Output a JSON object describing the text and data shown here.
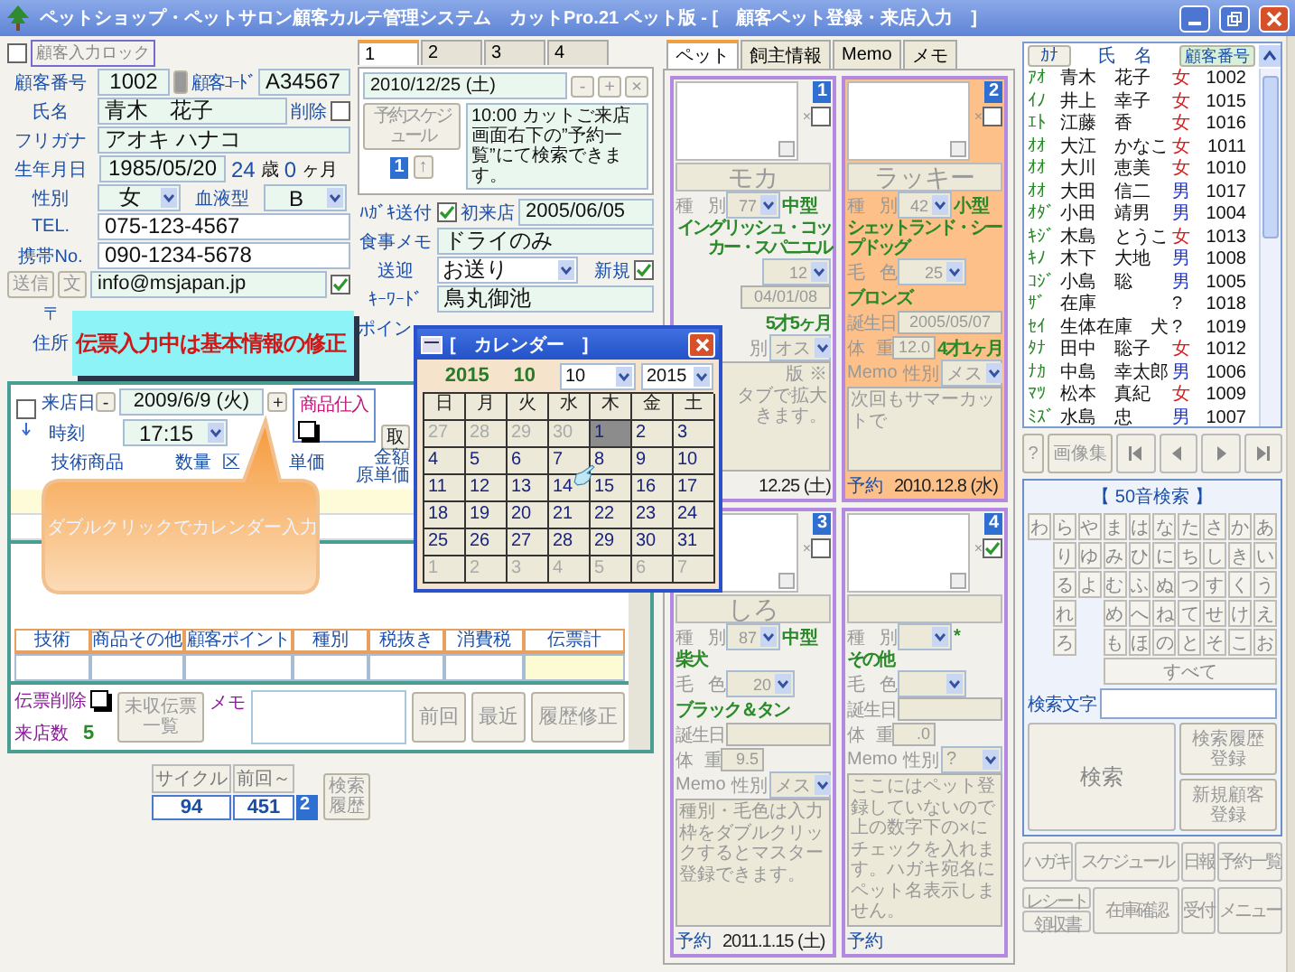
{
  "window": {
    "title": "ペットショップ・ペットサロン顧客カルテ管理システム　カットPro.21 ペット版 - [　顧客ペット登録・来店入力　]"
  },
  "lock": {
    "label": "顧客入力ロック",
    "checked": false
  },
  "customer": {
    "number": {
      "label": "顧客番号",
      "value": "1002"
    },
    "code": {
      "label": "顧客ｺｰﾄﾞ",
      "value": "A34567"
    },
    "name": {
      "label": "氏名",
      "value": "青木　花子"
    },
    "delete": {
      "label": "削除",
      "checked": false
    },
    "furigana": {
      "label": "フリガナ",
      "value": "アオキ ハナコ"
    },
    "birthday": {
      "label": "生年月日",
      "value": "1985/05/20",
      "years": "24",
      "years_unit": "歳",
      "months": "0",
      "months_unit": "ヶ月"
    },
    "sex": {
      "label": "性別",
      "value": "女"
    },
    "blood": {
      "label": "血液型",
      "value": "B"
    },
    "tel": {
      "label": "TEL.",
      "value": "075-123-4567"
    },
    "mobile": {
      "label": "携帯No.",
      "value": "090-1234-5678"
    },
    "mail": {
      "send_button": "送信",
      "text_button": "文",
      "value": "info@msjapan.jp",
      "checked": true
    },
    "zip_label": "〒",
    "address_label": "住所"
  },
  "reservation": {
    "tabs": [
      {
        "label": "1",
        "selected": true
      },
      {
        "label": "2",
        "selected": false
      },
      {
        "label": "3",
        "selected": false
      },
      {
        "label": "4",
        "selected": false
      }
    ],
    "date": "2010/12/25 (土)",
    "buttons": [
      "-",
      "+",
      "×"
    ],
    "schedule_button": "予約スケジュール",
    "page": "1",
    "up_button": "↑",
    "note": "10:00 カットご来店画面右下の”予約一覧”にて検索できます。"
  },
  "extra": {
    "postcard": {
      "label": "ﾊｶﾞｷ送付",
      "checked": true
    },
    "first_visit": {
      "label": "初来店",
      "value": "2005/06/05"
    },
    "meal": {
      "label": "食事メモ",
      "value": "ドライのみ"
    },
    "transport": {
      "label": "送迎",
      "value": "お送り"
    },
    "new": {
      "label": "新規",
      "checked": true
    },
    "keyword": {
      "label": "ｷｰﾜｰﾄﾞ",
      "value": "鳥丸御池"
    },
    "point_label": "ポイン"
  },
  "notice": "伝票入力中は基本情報の修正",
  "slip": {
    "row_checked": false,
    "goods_checked": false,
    "delete_checked": false,
    "visit_label": "来店日",
    "prev_button": "-",
    "date": "2009/6/9 (火)",
    "next_button": "+",
    "time_label": "時刻",
    "time": "17:15",
    "goods_label": "商品仕入",
    "take_button": "取",
    "columns": [
      "技術商品",
      "数量",
      "区",
      "単価"
    ],
    "amount_label": "金額",
    "cost_label": "原単価",
    "totals": [
      "技術",
      "商品その他",
      "顧客ポイント",
      "種別",
      "税抜き",
      "消費税",
      "伝票計"
    ],
    "delete_label": "伝票削除",
    "visits_label": "来店数",
    "visits": "5",
    "unpaid_button": "未収伝票一覧",
    "memo_label": "メモ",
    "buttons": [
      "前回",
      "最近",
      "履歴修正"
    ]
  },
  "cycle": {
    "cycle_label": "サイクル",
    "last_label": "前回～",
    "cycle": "94",
    "last": "451",
    "badge": "2",
    "history_button": "検索履歴"
  },
  "tooltip": "ダブルクリックでカレンダー入力",
  "calendar": {
    "title": "[　カレンダー　]",
    "year": "2015",
    "month": "10",
    "month_select": "10",
    "year_select": "2015",
    "weekdays": [
      "日",
      "月",
      "火",
      "水",
      "木",
      "金",
      "土"
    ],
    "days": [
      {
        "label": "27",
        "current": false,
        "selected": false
      },
      {
        "label": "28",
        "current": false,
        "selected": false
      },
      {
        "label": "29",
        "current": false,
        "selected": false
      },
      {
        "label": "30",
        "current": false,
        "selected": false
      },
      {
        "label": "1",
        "current": true,
        "selected": true
      },
      {
        "label": "2",
        "current": true,
        "selected": false
      },
      {
        "label": "3",
        "current": true,
        "selected": false
      },
      {
        "label": "4",
        "current": true,
        "selected": false
      },
      {
        "label": "5",
        "current": true,
        "selected": false
      },
      {
        "label": "6",
        "current": true,
        "selected": false
      },
      {
        "label": "7",
        "current": true,
        "selected": false
      },
      {
        "label": "8",
        "current": true,
        "selected": false
      },
      {
        "label": "9",
        "current": true,
        "selected": false
      },
      {
        "label": "10",
        "current": true,
        "selected": false
      },
      {
        "label": "11",
        "current": true,
        "selected": false
      },
      {
        "label": "12",
        "current": true,
        "selected": false
      },
      {
        "label": "13",
        "current": true,
        "selected": false
      },
      {
        "label": "14",
        "current": true,
        "selected": false
      },
      {
        "label": "15",
        "current": true,
        "selected": false
      },
      {
        "label": "16",
        "current": true,
        "selected": false
      },
      {
        "label": "17",
        "current": true,
        "selected": false
      },
      {
        "label": "18",
        "current": true,
        "selected": false
      },
      {
        "label": "19",
        "current": true,
        "selected": false
      },
      {
        "label": "20",
        "current": true,
        "selected": false
      },
      {
        "label": "21",
        "current": true,
        "selected": false
      },
      {
        "label": "22",
        "current": true,
        "selected": false
      },
      {
        "label": "23",
        "current": true,
        "selected": false
      },
      {
        "label": "24",
        "current": true,
        "selected": false
      },
      {
        "label": "25",
        "current": true,
        "selected": false
      },
      {
        "label": "26",
        "current": true,
        "selected": false
      },
      {
        "label": "27",
        "current": true,
        "selected": false
      },
      {
        "label": "28",
        "current": true,
        "selected": false
      },
      {
        "label": "29",
        "current": true,
        "selected": false
      },
      {
        "label": "30",
        "current": true,
        "selected": false
      },
      {
        "label": "31",
        "current": true,
        "selected": false
      },
      {
        "label": "1",
        "current": false,
        "selected": false
      },
      {
        "label": "2",
        "current": false,
        "selected": false
      },
      {
        "label": "3",
        "current": false,
        "selected": false
      },
      {
        "label": "4",
        "current": false,
        "selected": false
      },
      {
        "label": "5",
        "current": false,
        "selected": false
      },
      {
        "label": "6",
        "current": false,
        "selected": false
      },
      {
        "label": "7",
        "current": false,
        "selected": false
      }
    ]
  },
  "pets": {
    "tabs": [
      {
        "label": "ペット",
        "selected": true
      },
      {
        "label": "飼主情報",
        "selected": false
      },
      {
        "label": "Memo",
        "selected": false
      },
      {
        "label": "メモ",
        "selected": false
      }
    ],
    "cards": [
      {
        "number": "1",
        "exclude": {
          "label": "×",
          "checked": false
        },
        "selected": false,
        "covered": true,
        "name": "モカ",
        "species_label": "種　別",
        "species": "77",
        "size": "中型",
        "breed": "イングリッシュ・コッカー・スパニエル",
        "color_code": "12",
        "birthday": "04/01/08",
        "age": "5才5ヶ月",
        "sex_label": "別",
        "sex": "オス",
        "memo_lines": [
          "版 ※",
          "タブで拡大",
          "きます。"
        ],
        "reserve_date": "12.25 (土)"
      },
      {
        "number": "2",
        "exclude": {
          "label": "×",
          "checked": false
        },
        "selected": true,
        "covered": false,
        "name": "ラッキー",
        "species_label": "種　別",
        "species": "42",
        "size": "小型",
        "breed": "シェットランド・シープドッグ",
        "color_label": "毛　色",
        "color_code": "25",
        "color_name": "ブロンズ",
        "birth_label": "誕生日",
        "birthday": "2005/05/07",
        "weight_label": "体　重",
        "weight": "12.0",
        "age": "4才1ヶ月",
        "memo_label": "Memo",
        "sex_label": "性別",
        "sex": "メス",
        "memo": "次回もサマーカットで",
        "reserve_label": "予約",
        "reserve_date": "2010.12.8 (水)"
      },
      {
        "number": "3",
        "exclude": {
          "label": "×",
          "checked": false
        },
        "selected": false,
        "covered": false,
        "name": "しろ",
        "species_label": "種　別",
        "species": "87",
        "size": "中型",
        "breed": "柴犬",
        "color_label": "毛　色",
        "color_code": "20",
        "color_name": "ブラック＆タン",
        "birth_label": "誕生日",
        "weight_label": "体　重",
        "weight": "9.5",
        "memo_label": "Memo",
        "sex_label": "性別",
        "sex": "メス",
        "memo": "種別・毛色は入力枠をダブルクリックするとマスター登録できます。",
        "reserve_label": "予約",
        "reserve_date": "2011.1.15 (土)"
      },
      {
        "number": "4",
        "exclude": {
          "label": "×",
          "checked": true
        },
        "selected": false,
        "covered": false,
        "species_label": "種　別",
        "size": "*",
        "breed": "その他",
        "color_label": "毛　色",
        "birth_label": "誕生日",
        "weight_label": "体　重",
        "weight": ".0",
        "memo_label": "Memo",
        "sex_label": "性別",
        "sex": "?",
        "memo": "ここにはペット登録していないので上の数字下の×にチェックを入れます。ハガキ宛名にペット名表示しません。",
        "reserve_label": "予約"
      }
    ]
  },
  "customers": {
    "kana_button": "ｶﾅ",
    "name_header": "氏　名",
    "number_button": "顧客番号",
    "rows": [
      {
        "kana": "ｱｵ",
        "name": "青木　花子",
        "sex": "女",
        "kind": "female",
        "number": "1002"
      },
      {
        "kana": "ｲﾉ",
        "name": "井上　幸子",
        "sex": "女",
        "kind": "female",
        "number": "1015"
      },
      {
        "kana": "ｴﾄ",
        "name": "江藤　香",
        "sex": "女",
        "kind": "female",
        "number": "1016"
      },
      {
        "kana": "ｵｵ",
        "name": "大江　かなこ",
        "sex": "女",
        "kind": "female",
        "number": "1011"
      },
      {
        "kana": "ｵｵ",
        "name": "大川　恵美",
        "sex": "女",
        "kind": "female",
        "number": "1010"
      },
      {
        "kana": "ｵｵ",
        "name": "大田　信二",
        "sex": "男",
        "kind": "male",
        "number": "1017"
      },
      {
        "kana": "ｵﾀﾞ",
        "name": "小田　靖男",
        "sex": "男",
        "kind": "male",
        "number": "1004"
      },
      {
        "kana": "ｷｼﾞ",
        "name": "木島　とうこ",
        "sex": "女",
        "kind": "female",
        "number": "1013"
      },
      {
        "kana": "ｷﾉ",
        "name": "木下　大地",
        "sex": "男",
        "kind": "male",
        "number": "1008"
      },
      {
        "kana": "ｺｼﾞ",
        "name": "小島　聡",
        "sex": "男",
        "kind": "male",
        "number": "1005"
      },
      {
        "kana": "ｻﾞ",
        "name": "在庫",
        "sex": "?",
        "kind": "unknown",
        "number": "1018"
      },
      {
        "kana": "ｾｲ",
        "name": "生体在庫　犬",
        "sex": "?",
        "kind": "unknown",
        "number": "1019"
      },
      {
        "kana": "ﾀﾅ",
        "name": "田中　聡子",
        "sex": "女",
        "kind": "female",
        "number": "1012"
      },
      {
        "kana": "ﾅｶ",
        "name": "中島　幸太郎",
        "sex": "男",
        "kind": "male",
        "number": "1006"
      },
      {
        "kana": "ﾏﾂ",
        "name": "松本　真紀",
        "sex": "女",
        "kind": "female",
        "number": "1009"
      },
      {
        "kana": "ﾐｽﾞ",
        "name": "水島　忠",
        "sex": "男",
        "kind": "male",
        "number": "1007"
      }
    ]
  },
  "nav": {
    "help_button": "?",
    "gallery_button": "画像集"
  },
  "kana_search": {
    "title": "【 50音検索 】",
    "columns": [
      [
        "わ"
      ],
      [
        "ら",
        "り",
        "る",
        "れ",
        "ろ"
      ],
      [
        "や",
        "ゆ",
        "よ"
      ],
      [
        "ま",
        "み",
        "む",
        "め",
        "も"
      ],
      [
        "は",
        "ひ",
        "ふ",
        "へ",
        "ほ"
      ],
      [
        "な",
        "に",
        "ぬ",
        "ね",
        "の"
      ],
      [
        "た",
        "ち",
        "つ",
        "て",
        "と"
      ],
      [
        "さ",
        "し",
        "す",
        "せ",
        "そ"
      ],
      [
        "か",
        "き",
        "く",
        "け",
        "こ"
      ],
      [
        "あ",
        "い",
        "う",
        "え",
        "お"
      ]
    ],
    "all_button": "すべて",
    "search_label": "検索文字",
    "search_button": "検索",
    "history_button": "検索履歴登録",
    "new_button": "新規顧客登録"
  },
  "menu_buttons": {
    "row1": [
      "ハガキ",
      "スケジュール",
      "日報",
      "予約一覧"
    ],
    "receipt": "レシート",
    "invoice": "領収書",
    "row2": [
      "在庫確認",
      "受付",
      "メニュー"
    ]
  }
}
